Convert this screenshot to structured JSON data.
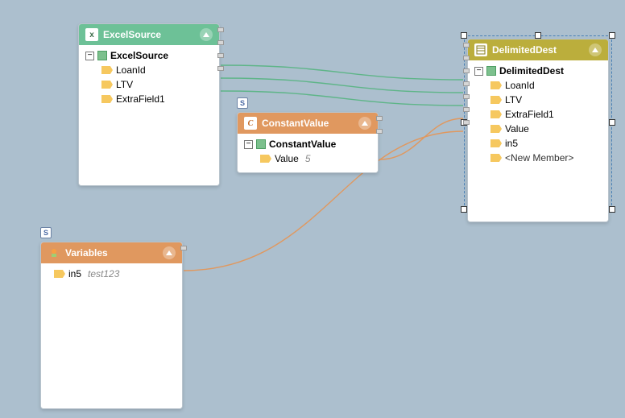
{
  "nodes": {
    "excel": {
      "title": "ExcelSource",
      "root": "ExcelSource",
      "fields": [
        "LoanId",
        "LTV",
        "ExtraField1"
      ]
    },
    "constant": {
      "title": "ConstantValue",
      "root": "ConstantValue",
      "field": "Value",
      "fieldValue": "5"
    },
    "variables": {
      "title": "Variables",
      "field": "in5",
      "fieldValue": "test123"
    },
    "dest": {
      "title": "DelimitedDest",
      "root": "DelimitedDest",
      "fields": [
        "LoanId",
        "LTV",
        "ExtraField1",
        "Value",
        "in5"
      ],
      "newMember": "<New Member>"
    }
  },
  "badges": {
    "s": "S"
  },
  "colors": {
    "greenWire": "#5eb588",
    "orangeWire": "#e0985f"
  }
}
